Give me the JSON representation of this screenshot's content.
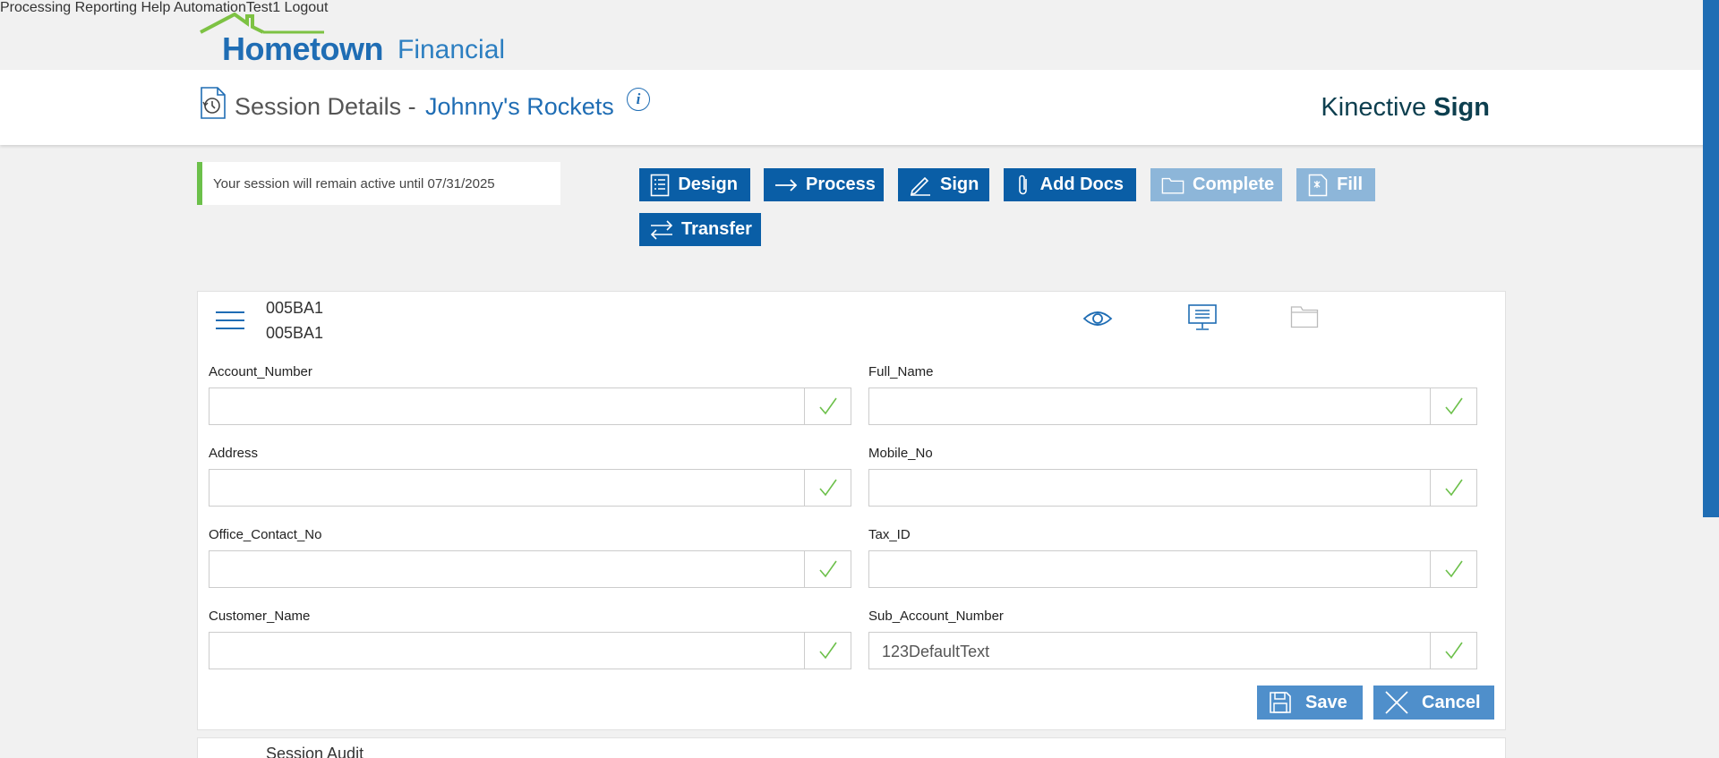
{
  "brand": {
    "name": "Hometown",
    "suffix": "Financial"
  },
  "nav": {
    "processing": "Processing",
    "reporting": "Reporting",
    "help": "Help",
    "user": "AutomationTest1",
    "logout": "Logout"
  },
  "header": {
    "title": "Session Details -",
    "session_name": "Johnny's Rockets",
    "info_glyph": "i",
    "product_a": "Kinective",
    "product_b": "Sign"
  },
  "status": {
    "message": "Your session will remain active until 07/31/2025",
    "accent_color": "#6cc04a"
  },
  "actions": {
    "design": "Design",
    "process": "Process",
    "sign": "Sign",
    "add_docs": "Add Docs",
    "complete": "Complete",
    "fill": "Fill",
    "transfer": "Transfer",
    "complete_disabled": true,
    "fill_disabled": true
  },
  "document": {
    "id_line1": "005BA1",
    "id_line2": "005BA1"
  },
  "fields": {
    "account_number": {
      "label": "Account_Number",
      "value": ""
    },
    "full_name": {
      "label": "Full_Name",
      "value": ""
    },
    "address": {
      "label": "Address",
      "value": ""
    },
    "mobile_no": {
      "label": "Mobile_No",
      "value": ""
    },
    "office_contact_no": {
      "label": "Office_Contact_No",
      "value": ""
    },
    "tax_id": {
      "label": "Tax_ID",
      "value": ""
    },
    "customer_name": {
      "label": "Customer_Name",
      "value": ""
    },
    "sub_account_number": {
      "label": "Sub_Account_Number",
      "value": "123DefaultText"
    }
  },
  "form_buttons": {
    "save": "Save",
    "cancel": "Cancel"
  },
  "next_section": {
    "title": "Session Audit"
  },
  "colors": {
    "primary": "#0a5ea6",
    "disabled": "#8db6d9",
    "check": "#6cc04a",
    "brand_green": "#7dc243"
  }
}
